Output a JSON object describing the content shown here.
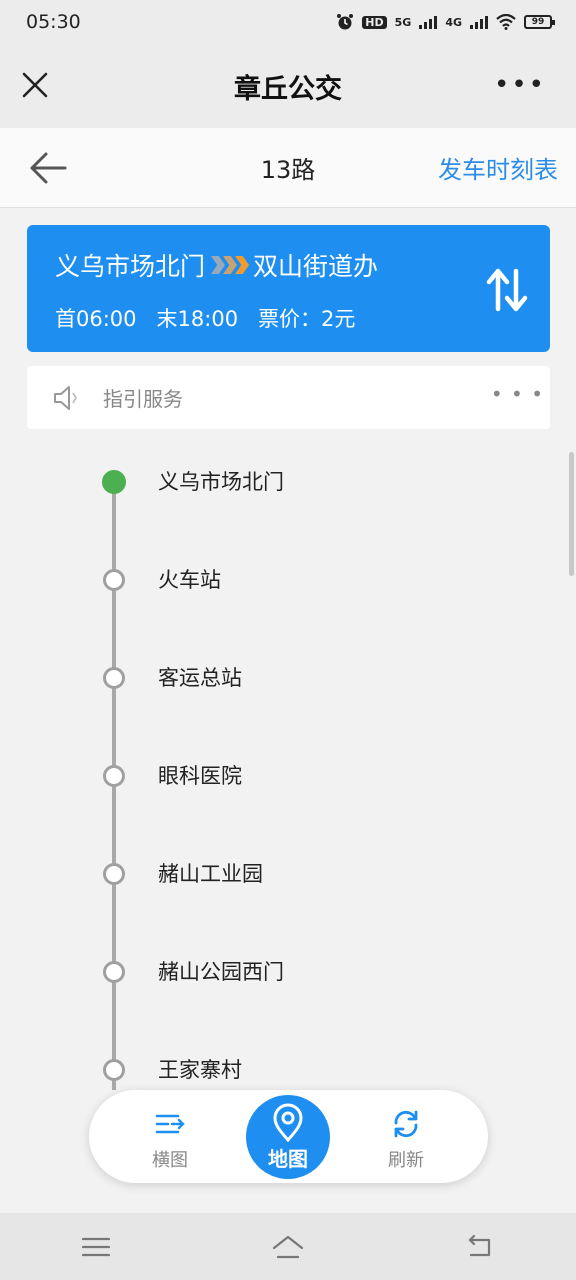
{
  "status_bar": {
    "time": "05:30",
    "hd": "HD",
    "net_5g": "5G",
    "net_4g": "4G",
    "battery": "99"
  },
  "app_title": "章丘公交",
  "nav": {
    "route_name": "13路",
    "schedule_link": "发车时刻表"
  },
  "route_card": {
    "from": "义乌市场北门",
    "to": "双山街道办",
    "first_bus": "首06:00",
    "last_bus": "末18:00",
    "fare": "票价：2元"
  },
  "guide": {
    "label": "指引服务"
  },
  "stops": [
    {
      "name": "义乌市场北门"
    },
    {
      "name": "火车站"
    },
    {
      "name": "客运总站"
    },
    {
      "name": "眼科医院"
    },
    {
      "name": "赭山工业园"
    },
    {
      "name": "赭山公园西门"
    },
    {
      "name": "王家寨村"
    }
  ],
  "floating_bar": {
    "horizontal_label": "横图",
    "map_label": "地图",
    "refresh_label": "刷新"
  },
  "colors": {
    "accent": "#1e8ff1",
    "link": "#2b8de8",
    "start_stop": "#4caf50",
    "chevron": "#f39a2d"
  }
}
